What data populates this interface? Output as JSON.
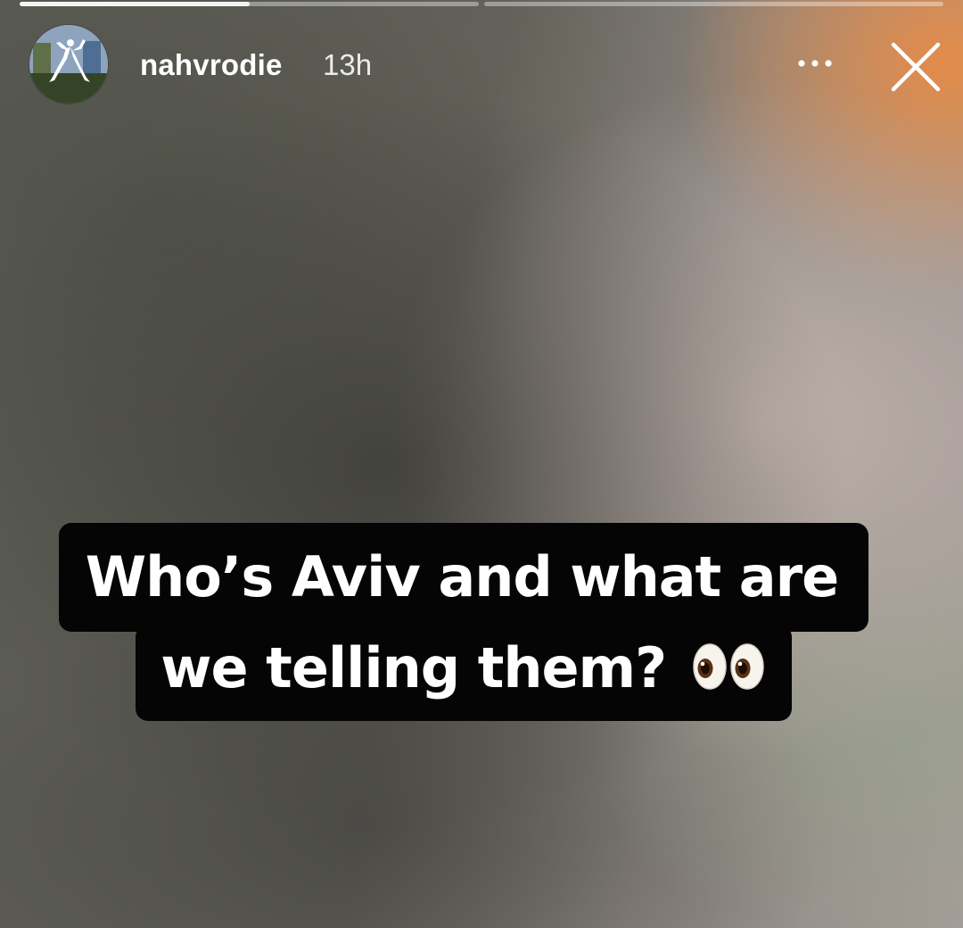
{
  "story": {
    "progress": [
      {
        "segment": 1,
        "fraction": 0.5
      },
      {
        "segment": 2,
        "fraction": 0.0
      }
    ]
  },
  "header": {
    "username": "nahvrodie",
    "timestamp": "13h",
    "more_icon": "more-dots-icon",
    "close_icon": "close-icon"
  },
  "caption": {
    "line_one": "Who’s Aviv and what are",
    "line_two": "we telling them?",
    "emoji": "eyes"
  },
  "colors": {
    "accent_orange": "#e88c46",
    "text_white": "#ffffff",
    "caption_bg": "#050505"
  }
}
